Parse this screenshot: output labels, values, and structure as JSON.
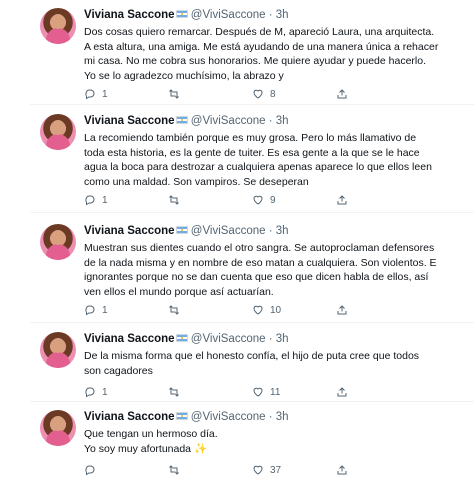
{
  "tweets": [
    {
      "name": "Viviana Saccone",
      "handle": "@ViviSaccone",
      "sep": "·",
      "time": "3h",
      "lines": [
        "Dos cosas quiero remarcar. Después de M, apareció Laura, una arquitecta.",
        "A esta altura, una amiga. Me está ayudando de una manera única a rehacer",
        "mi casa. No me cobra sus honorarios. Me quiere ayudar y puede hacerlo.",
        "Yo se lo agradezco muchísimo, la abrazo y"
      ],
      "replies": "1",
      "retweets": "",
      "likes": "8"
    },
    {
      "name": "Viviana Saccone",
      "handle": "@ViviSaccone",
      "sep": "·",
      "time": "3h",
      "lines": [
        "La recomiendo también porque es muy grosa.  Pero lo más llamativo de",
        "toda esta historia, es la gente de tuiter. Es esa gente a la que se le hace",
        "agua la boca para destrozar a cualquiera apenas aparece lo que ellos leen",
        "como una maldad. Son vampiros. Se deseperan"
      ],
      "replies": "1",
      "retweets": "",
      "likes": "9"
    },
    {
      "name": "Viviana Saccone",
      "handle": "@ViviSaccone",
      "sep": "·",
      "time": "3h",
      "lines": [
        "Muestran sus dientes cuando el otro sangra. Se autoproclaman defensores",
        "de la nada misma y en nombre de eso matan a cualquiera. Son violentos. E",
        "ignorantes porque no se dan cuenta que eso que dicen habla de ellos, así",
        "ven ellos el mundo porque así actuarían."
      ],
      "replies": "1",
      "retweets": "",
      "likes": "10"
    },
    {
      "name": "Viviana Saccone",
      "handle": "@ViviSaccone",
      "sep": "·",
      "time": "3h",
      "lines": [
        "De la misma forma que el honesto confía, el hijo de puta cree que todos",
        "son cagadores"
      ],
      "replies": "1",
      "retweets": "",
      "likes": "11"
    },
    {
      "name": "Viviana Saccone",
      "handle": "@ViviSaccone",
      "sep": "·",
      "time": "3h",
      "lines": [
        "Que tengan un hermoso día.",
        "Yo soy muy afortunada"
      ],
      "sparkle": "✨",
      "replies": "",
      "retweets": "",
      "likes": "37"
    }
  ]
}
